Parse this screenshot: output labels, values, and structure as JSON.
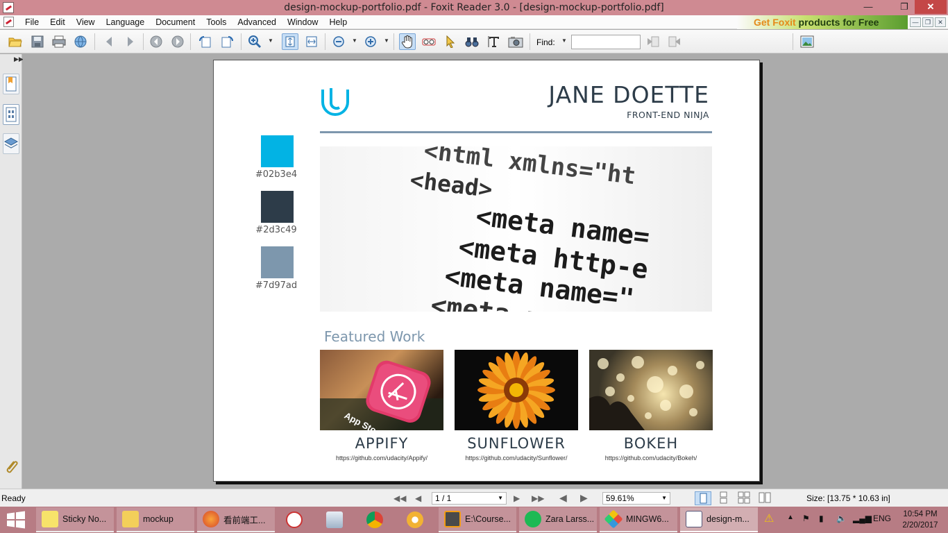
{
  "window": {
    "title": "design-mockup-portfolio.pdf - Foxit Reader 3.0 - [design-mockup-portfolio.pdf]"
  },
  "menu": [
    "File",
    "Edit",
    "View",
    "Language",
    "Document",
    "Tools",
    "Advanced",
    "Window",
    "Help"
  ],
  "promo": {
    "part1": "Get Foxit",
    "part2": " products for Free"
  },
  "toolbar": {
    "find_label": "Find:",
    "find_value": ""
  },
  "document": {
    "name": "JANE DOETTE",
    "role": "FRONT-END NINJA",
    "swatches": [
      {
        "color": "#02b3e4",
        "label": "#02b3e4"
      },
      {
        "color": "#2d3c49",
        "label": "#2d3c49"
      },
      {
        "color": "#7d97ad",
        "label": "#7d97ad"
      }
    ],
    "hero_code": [
      "<html xmlns=\"ht",
      "<head>",
      "<meta name=",
      "<meta http-e",
      "<meta name=\"",
      "<meta n"
    ],
    "featured_heading": "Featured Work",
    "works": [
      {
        "title": "APPIFY",
        "link": "https://github.com/udacity/Appify/"
      },
      {
        "title": "SUNFLOWER",
        "link": "https://github.com/udacity/Sunflower/"
      },
      {
        "title": "BOKEH",
        "link": "https://github.com/udacity/Bokeh/"
      }
    ]
  },
  "status": {
    "text": "Ready",
    "page": "1 / 1",
    "zoom": "59.61%",
    "size": "Size: [13.75 * 10.63 in]"
  },
  "taskbar": {
    "tasks": [
      "Sticky No...",
      "mockup",
      "看前端工...",
      "E:\\Course...",
      "Zara Larss...",
      "MINGW6...",
      "design-m..."
    ],
    "lang": "ENG",
    "time": "10:54 PM",
    "date": "2/20/2017"
  },
  "colors": {
    "accent": "#02b3e4",
    "dark": "#2d3c49",
    "muted": "#7d97ad",
    "titlebar": "#cf8a92",
    "taskbar": "#b77c84"
  }
}
